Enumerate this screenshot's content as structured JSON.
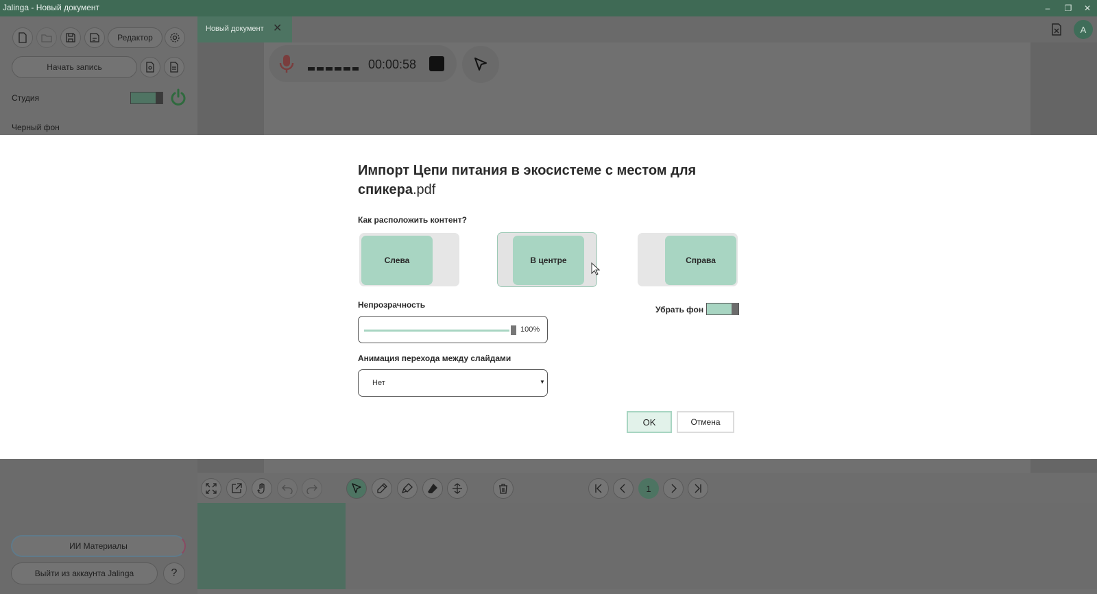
{
  "window": {
    "title": "Jalinga - Новый документ",
    "minimize_glyph": "–",
    "restore_glyph": "❐",
    "close_glyph": "✕"
  },
  "sidebar": {
    "editor_label": "Редактор",
    "start_record_label": "Начать запись",
    "studio_label": "Студия",
    "studio_toggle_on": true,
    "black_bg_label": "Черный фон",
    "black_bg_toggle_on": false,
    "ai_materials_label": "ИИ Материалы",
    "logout_label": "Выйти из аккаунта Jalinga",
    "help_glyph": "?"
  },
  "document": {
    "tab_label": "Новый документ",
    "tab_close_glyph": "✕",
    "recorder_time": "00:00:58",
    "avatar_letter": "A"
  },
  "dialog": {
    "title_main": "Импорт Цепи питания в экосистеме с местом для спикера",
    "title_ext": ".pdf",
    "layout_question": "Как расположить контент?",
    "layout_options": [
      {
        "label": "Слева",
        "selected": false
      },
      {
        "label": "В центре",
        "selected": true
      },
      {
        "label": "Справа",
        "selected": false
      }
    ],
    "opacity_label": "Непрозрачность",
    "opacity_value": "100%",
    "opacity_fraction": 1.0,
    "remove_bg_label": "Убрать фон",
    "remove_bg_on": true,
    "animation_label": "Анимация перехода между слайдами",
    "animation_value": "Нет",
    "ok_label": "OK",
    "cancel_label": "Отмена"
  },
  "bottom_toolbar": {
    "current_page": "1"
  },
  "colors": {
    "accent": "#a8d5c2",
    "accent_dark": "#4d7462",
    "titlebar": "#3f6a55"
  }
}
